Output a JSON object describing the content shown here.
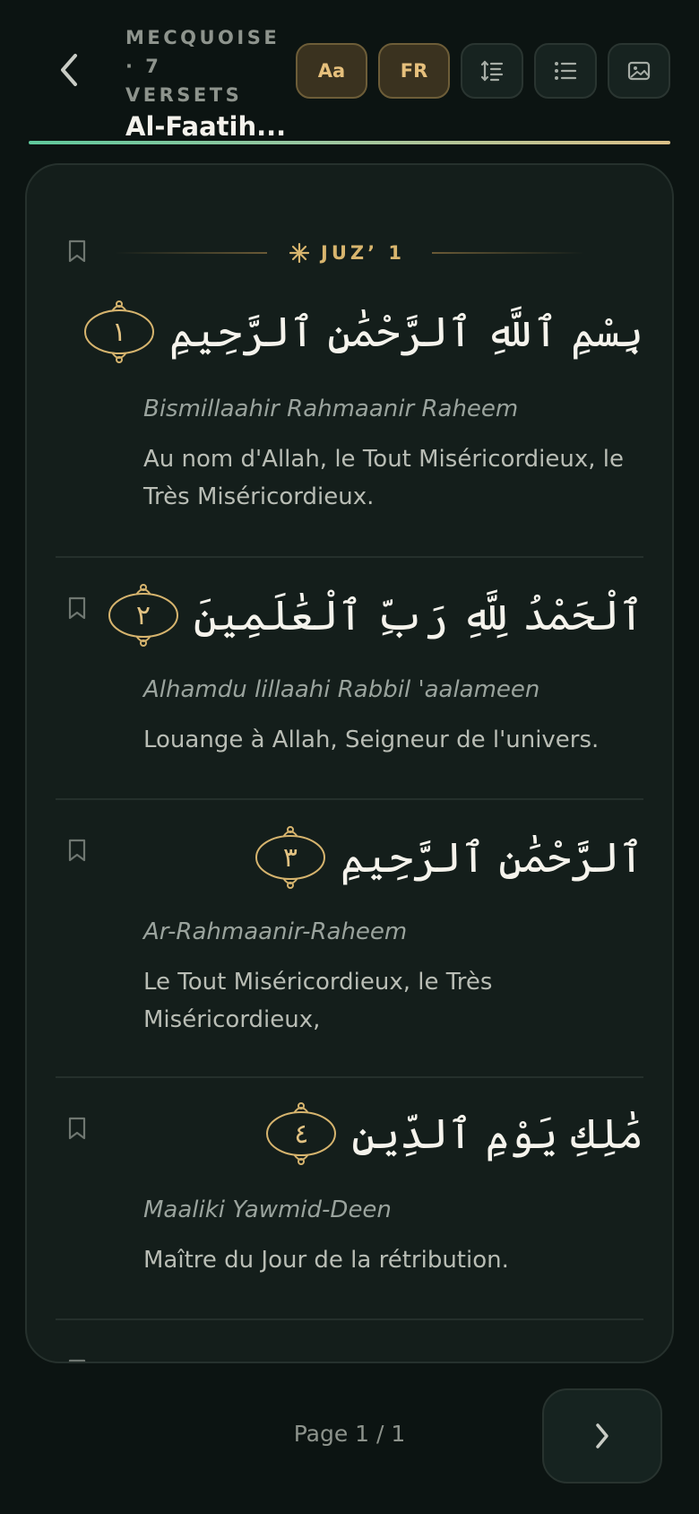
{
  "header": {
    "meta_line1": "MECQUOISE",
    "meta_line2": "· 7 VERSETS",
    "title": "Al-Faatih...",
    "font_button_label": "Aa",
    "lang_button_label": "FR"
  },
  "colors": {
    "background": "#0c1412",
    "card": "#141e1b",
    "gold": "#d8b56e",
    "progress_start": "#5fc89c",
    "progress_end": "#dcc088"
  },
  "icons": {
    "back": "chevron-left-icon",
    "layout": "line-spacing-icon",
    "list": "list-icon",
    "image": "image-icon",
    "bookmark": "bookmark-icon",
    "juz": "star-icon",
    "next": "chevron-right-icon"
  },
  "juz": {
    "label": "JUZ’ 1"
  },
  "verses": [
    {
      "arabic": "بِسْمِ ٱللَّهِ ٱلرَّحْمَٰنِ ٱلرَّحِيمِ",
      "number": "١",
      "transliteration": "Bismillaahir Rahmaanir Raheem",
      "translation": "Au nom d'Allah, le Tout Miséricordieux, le Très Miséricordieux."
    },
    {
      "arabic": "ٱلْحَمْدُ لِلَّهِ رَبِّ ٱلْعَٰلَمِينَ",
      "number": "٢",
      "transliteration": "Alhamdu lillaahi Rabbil 'aalameen",
      "translation": "Louange à Allah, Seigneur de l'univers."
    },
    {
      "arabic": "ٱلرَّحْمَٰنِ ٱلرَّحِيمِ",
      "number": "٣",
      "transliteration": "Ar-Rahmaanir-Raheem",
      "translation": "Le Tout Miséricordieux, le Très Miséricordieux,"
    },
    {
      "arabic": "مَٰلِكِ يَوْمِ ٱلدِّينِ",
      "number": "٤",
      "transliteration": "Maaliki Yawmid-Deen",
      "translation": "Maître du Jour de la rétribution."
    }
  ],
  "footer": {
    "page_indicator": "Page 1 / 1"
  }
}
